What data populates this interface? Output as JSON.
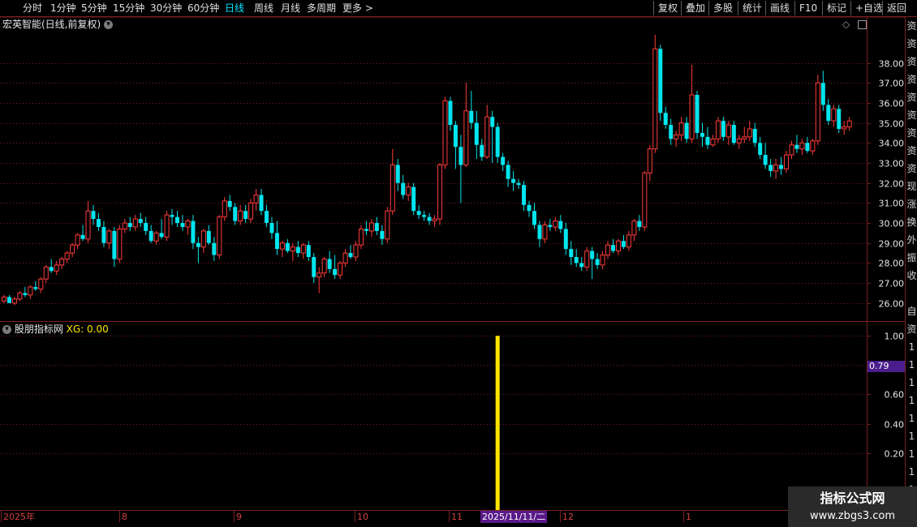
{
  "toolbar": {
    "left": [
      "分时",
      "1分钟",
      "5分钟",
      "15分钟",
      "30分钟",
      "60分钟",
      "日线",
      "周线",
      "月线",
      "多周期",
      "更多 >"
    ],
    "active_index": 6,
    "right": [
      "复权",
      "叠加",
      "多股",
      "统计",
      "画线",
      "F10",
      "标记",
      "+自选",
      "返回"
    ]
  },
  "main_title": "宏英智能(日线,前复权)",
  "sub_title": "股朋指标网",
  "xg_label": "XG: 0.00",
  "side_glyphs": [
    "资",
    "资",
    "资",
    "资",
    "资",
    "资",
    "资",
    "资",
    "资",
    "现",
    "涨",
    "换",
    "外",
    "振",
    "收",
    "",
    "自",
    "资",
    "1",
    "1",
    "1",
    "1",
    "1",
    "1",
    "1",
    "1",
    "1"
  ],
  "watermark": {
    "line1": "指标公式网",
    "line2": "www.zbgs3.com"
  },
  "cursor_date": "2025/11/11/二",
  "cursor_value": "0.79",
  "colors": {
    "up": "#ff3b3b",
    "down": "#00e5ee",
    "signal": "#ffe600",
    "grid": "#7a1f1f",
    "axis_text": "#e6e6e6"
  },
  "chart_data": [
    {
      "type": "candlestick",
      "title": "宏英智能(日线,前复权)",
      "y_ticks": [
        26.0,
        27.0,
        28.0,
        29.0,
        30.0,
        31.0,
        32.0,
        33.0,
        34.0,
        35.0,
        36.0,
        37.0,
        38.0
      ],
      "ylim": [
        25.1,
        39.6
      ],
      "x_labels": [
        "2025年",
        "8",
        "9",
        "10",
        "11",
        "12",
        "1"
      ],
      "x_label_dates": [
        "2025-07-01",
        "2025-08-01",
        "2025-09-01",
        "2025-10-09",
        "2025-11-03",
        "2025-12-01",
        "2026-01-05"
      ],
      "candles": [
        [
          26.1,
          26.4,
          26.0,
          26.3
        ],
        [
          26.3,
          26.4,
          26.0,
          26.0
        ],
        [
          26.0,
          26.3,
          25.9,
          26.2
        ],
        [
          26.2,
          26.6,
          26.1,
          26.5
        ],
        [
          26.5,
          26.8,
          26.3,
          26.4
        ],
        [
          26.4,
          26.9,
          26.2,
          26.8
        ],
        [
          26.8,
          27.1,
          26.6,
          26.7
        ],
        [
          26.7,
          27.3,
          26.5,
          27.2
        ],
        [
          27.2,
          27.9,
          27.0,
          27.8
        ],
        [
          27.8,
          28.2,
          27.5,
          27.6
        ],
        [
          27.6,
          28.1,
          27.4,
          27.9
        ],
        [
          27.9,
          28.3,
          27.7,
          28.2
        ],
        [
          28.2,
          28.6,
          28.0,
          28.5
        ],
        [
          28.5,
          29.0,
          28.3,
          28.9
        ],
        [
          28.9,
          29.5,
          28.7,
          29.4
        ],
        [
          29.4,
          29.9,
          29.1,
          29.2
        ],
        [
          29.2,
          31.1,
          29.0,
          30.6
        ],
        [
          30.6,
          30.9,
          29.9,
          30.2
        ],
        [
          30.2,
          30.5,
          29.6,
          29.8
        ],
        [
          29.8,
          30.1,
          28.8,
          29.0
        ],
        [
          29.0,
          29.7,
          28.7,
          29.6
        ],
        [
          29.6,
          29.8,
          27.8,
          28.2
        ],
        [
          28.2,
          29.9,
          28.0,
          29.7
        ],
        [
          29.7,
          30.2,
          29.5,
          30.0
        ],
        [
          30.0,
          30.3,
          29.6,
          29.8
        ],
        [
          29.8,
          30.4,
          29.6,
          30.2
        ],
        [
          30.2,
          30.5,
          29.8,
          30.0
        ],
        [
          30.0,
          30.3,
          29.4,
          29.6
        ],
        [
          29.6,
          29.9,
          29.0,
          29.1
        ],
        [
          29.1,
          29.6,
          28.9,
          29.5
        ],
        [
          29.5,
          30.2,
          29.2,
          29.3
        ],
        [
          29.3,
          30.6,
          29.1,
          30.4
        ],
        [
          30.4,
          30.7,
          29.9,
          30.3
        ],
        [
          30.3,
          30.6,
          29.8,
          30.0
        ],
        [
          30.0,
          30.4,
          29.6,
          29.8
        ],
        [
          29.8,
          30.2,
          29.4,
          30.1
        ],
        [
          30.1,
          30.4,
          28.7,
          29.0
        ],
        [
          29.0,
          29.3,
          28.0,
          28.8
        ],
        [
          28.8,
          29.7,
          28.5,
          29.6
        ],
        [
          29.6,
          29.9,
          28.9,
          29.0
        ],
        [
          29.0,
          29.3,
          28.1,
          28.4
        ],
        [
          28.4,
          30.4,
          28.2,
          30.3
        ],
        [
          30.3,
          31.3,
          30.1,
          31.1
        ],
        [
          31.1,
          31.4,
          30.6,
          30.8
        ],
        [
          30.8,
          31.0,
          29.9,
          30.1
        ],
        [
          30.1,
          30.9,
          29.9,
          30.6
        ],
        [
          30.6,
          30.9,
          30.0,
          30.2
        ],
        [
          30.2,
          31.2,
          30.0,
          31.0
        ],
        [
          31.0,
          31.7,
          30.6,
          31.4
        ],
        [
          31.4,
          31.7,
          30.4,
          30.6
        ],
        [
          30.6,
          30.9,
          29.8,
          30.0
        ],
        [
          30.0,
          30.3,
          29.2,
          29.5
        ],
        [
          29.5,
          30.1,
          28.4,
          28.7
        ],
        [
          28.7,
          29.1,
          28.3,
          29.0
        ],
        [
          29.0,
          29.2,
          28.5,
          28.6
        ],
        [
          28.6,
          29.0,
          28.1,
          28.8
        ],
        [
          28.8,
          29.1,
          28.3,
          28.5
        ],
        [
          28.5,
          29.0,
          28.2,
          28.9
        ],
        [
          28.9,
          29.1,
          28.1,
          28.3
        ],
        [
          28.3,
          28.5,
          27.0,
          27.3
        ],
        [
          27.3,
          27.8,
          26.5,
          27.5
        ],
        [
          27.5,
          28.3,
          27.3,
          28.2
        ],
        [
          28.2,
          28.6,
          27.5,
          27.7
        ],
        [
          27.7,
          28.4,
          27.2,
          27.4
        ],
        [
          27.4,
          28.1,
          27.2,
          28.0
        ],
        [
          28.0,
          28.7,
          27.8,
          28.5
        ],
        [
          28.5,
          28.9,
          28.2,
          28.3
        ],
        [
          28.3,
          29.1,
          28.1,
          28.9
        ],
        [
          28.9,
          29.9,
          28.7,
          29.7
        ],
        [
          29.7,
          30.1,
          29.4,
          29.6
        ],
        [
          29.6,
          30.2,
          29.3,
          30.0
        ],
        [
          30.0,
          30.3,
          29.4,
          29.6
        ],
        [
          29.6,
          29.9,
          28.9,
          29.2
        ],
        [
          29.2,
          30.8,
          29.0,
          30.6
        ],
        [
          30.6,
          33.7,
          30.4,
          32.9
        ],
        [
          32.9,
          33.2,
          31.6,
          32.0
        ],
        [
          32.0,
          32.4,
          31.2,
          31.4
        ],
        [
          31.4,
          32.0,
          31.1,
          31.8
        ],
        [
          31.8,
          32.0,
          30.4,
          30.6
        ],
        [
          30.6,
          30.9,
          30.2,
          30.4
        ],
        [
          30.4,
          30.6,
          30.1,
          30.3
        ],
        [
          30.3,
          30.5,
          29.9,
          30.1
        ],
        [
          30.1,
          30.4,
          29.8,
          30.2
        ],
        [
          30.2,
          33.0,
          29.9,
          32.9
        ],
        [
          32.9,
          36.3,
          32.7,
          36.1
        ],
        [
          36.1,
          36.3,
          34.6,
          34.9
        ],
        [
          34.9,
          35.1,
          32.7,
          33.8
        ],
        [
          33.8,
          34.4,
          31.0,
          32.9
        ],
        [
          32.9,
          37.0,
          32.8,
          35.6
        ],
        [
          35.6,
          36.6,
          34.7,
          35.0
        ],
        [
          35.0,
          35.6,
          33.2,
          33.9
        ],
        [
          33.9,
          34.2,
          33.1,
          33.3
        ],
        [
          33.3,
          35.9,
          33.2,
          35.3
        ],
        [
          35.3,
          35.6,
          33.0,
          34.8
        ],
        [
          34.8,
          35.0,
          33.0,
          33.3
        ],
        [
          33.3,
          33.5,
          32.6,
          32.9
        ],
        [
          32.9,
          33.1,
          31.8,
          32.2
        ],
        [
          32.2,
          32.6,
          31.6,
          32.0
        ],
        [
          32.0,
          32.2,
          31.7,
          31.9
        ],
        [
          31.9,
          32.1,
          30.6,
          30.9
        ],
        [
          30.9,
          31.1,
          30.3,
          30.6
        ],
        [
          30.6,
          31.0,
          29.7,
          29.9
        ],
        [
          29.9,
          30.1,
          28.8,
          29.2
        ],
        [
          29.2,
          30.1,
          29.0,
          29.9
        ],
        [
          29.9,
          30.2,
          29.6,
          29.8
        ],
        [
          29.8,
          30.3,
          29.6,
          30.1
        ],
        [
          30.1,
          30.4,
          29.5,
          29.7
        ],
        [
          29.7,
          30.0,
          28.4,
          28.7
        ],
        [
          28.7,
          29.1,
          27.9,
          28.3
        ],
        [
          28.3,
          28.7,
          27.8,
          28.0
        ],
        [
          28.0,
          28.3,
          27.6,
          27.8
        ],
        [
          27.8,
          28.8,
          27.6,
          28.6
        ],
        [
          28.6,
          28.8,
          27.2,
          28.2
        ],
        [
          28.2,
          28.5,
          27.7,
          27.9
        ],
        [
          27.9,
          28.6,
          27.7,
          28.4
        ],
        [
          28.4,
          29.1,
          28.2,
          28.9
        ],
        [
          28.9,
          29.2,
          28.5,
          28.6
        ],
        [
          28.6,
          29.2,
          28.4,
          29.1
        ],
        [
          29.1,
          29.4,
          28.7,
          28.8
        ],
        [
          28.8,
          29.6,
          28.6,
          29.4
        ],
        [
          29.4,
          30.2,
          29.1,
          30.1
        ],
        [
          30.1,
          30.4,
          29.6,
          29.8
        ],
        [
          29.8,
          32.6,
          29.6,
          32.5
        ],
        [
          32.5,
          33.9,
          32.1,
          33.7
        ],
        [
          33.7,
          39.4,
          33.5,
          38.7
        ],
        [
          38.7,
          38.9,
          35.1,
          35.5
        ],
        [
          35.5,
          35.8,
          34.7,
          34.9
        ],
        [
          34.9,
          35.2,
          33.9,
          34.2
        ],
        [
          34.2,
          34.6,
          33.8,
          34.4
        ],
        [
          34.4,
          35.3,
          34.1,
          35.0
        ],
        [
          35.0,
          35.3,
          34.0,
          34.2
        ],
        [
          34.2,
          37.9,
          34.0,
          36.4
        ],
        [
          36.4,
          36.6,
          34.2,
          34.5
        ],
        [
          34.5,
          35.0,
          33.8,
          34.3
        ],
        [
          34.3,
          34.8,
          33.7,
          33.9
        ],
        [
          33.9,
          34.4,
          33.8,
          34.2
        ],
        [
          34.2,
          35.3,
          34.0,
          35.1
        ],
        [
          35.1,
          35.3,
          34.1,
          34.3
        ],
        [
          34.3,
          35.1,
          33.9,
          34.9
        ],
        [
          34.9,
          35.1,
          33.9,
          34.0
        ],
        [
          34.0,
          34.4,
          33.7,
          34.2
        ],
        [
          34.2,
          34.8,
          34.0,
          34.3
        ],
        [
          34.3,
          35.1,
          34.1,
          34.7
        ],
        [
          34.7,
          35.0,
          33.8,
          34.0
        ],
        [
          34.0,
          34.3,
          33.2,
          33.4
        ],
        [
          33.4,
          34.0,
          32.7,
          32.9
        ],
        [
          32.9,
          33.2,
          32.3,
          32.6
        ],
        [
          32.6,
          33.2,
          32.2,
          32.9
        ],
        [
          32.9,
          33.3,
          32.4,
          32.7
        ],
        [
          32.7,
          33.6,
          32.5,
          33.4
        ],
        [
          33.4,
          34.1,
          33.2,
          33.9
        ],
        [
          33.9,
          34.4,
          33.5,
          33.7
        ],
        [
          33.7,
          34.2,
          33.4,
          34.0
        ],
        [
          34.0,
          34.3,
          33.5,
          33.6
        ],
        [
          33.6,
          34.2,
          33.4,
          34.1
        ],
        [
          34.1,
          37.4,
          33.9,
          37.0
        ],
        [
          37.0,
          37.6,
          35.6,
          35.9
        ],
        [
          35.9,
          36.2,
          34.9,
          35.1
        ],
        [
          35.1,
          35.9,
          34.8,
          35.7
        ],
        [
          35.7,
          35.9,
          34.5,
          34.7
        ],
        [
          34.7,
          35.1,
          34.4,
          34.8
        ],
        [
          34.8,
          35.3,
          34.6,
          35.1
        ]
      ]
    },
    {
      "type": "bar",
      "series": [
        {
          "name": "XG",
          "values": [
            1.0
          ]
        }
      ],
      "signal_date": "2025/11/11/二",
      "y_ticks": [
        0.2,
        0.4,
        0.6,
        0.8,
        1.0
      ],
      "ylim": [
        -0.19,
        1.09
      ]
    }
  ]
}
